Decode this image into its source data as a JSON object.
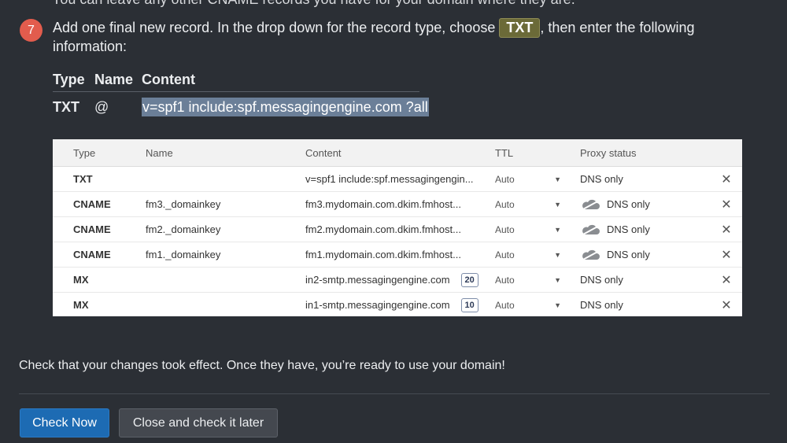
{
  "intro_cut_text": "You can leave any other CNAME records you have for your domain where they are.",
  "step": {
    "number": "7",
    "text_before": "Add one final new record. In the drop down for the record type, choose ",
    "tag": "TXT",
    "text_after": ", then enter the following information:"
  },
  "summary": {
    "headers": [
      "Type",
      "Name",
      "Content"
    ],
    "type": "TXT",
    "name": "@",
    "content": "v=spf1 include:spf.messagingengine.com ?all"
  },
  "dns_panel": {
    "headers": {
      "type": "Type",
      "name": "Name",
      "content": "Content",
      "ttl": "TTL",
      "proxy": "Proxy status"
    },
    "rows": [
      {
        "type": "TXT",
        "name": "",
        "content": "v=spf1 include:spf.messagingengin...",
        "priority": "",
        "ttl": "Auto",
        "proxy": "DNS only",
        "cloud": false
      },
      {
        "type": "CNAME",
        "name": "fm3._domainkey",
        "content": "fm3.mydomain.com.dkim.fmhost...",
        "priority": "",
        "ttl": "Auto",
        "proxy": "DNS only",
        "cloud": true
      },
      {
        "type": "CNAME",
        "name": "fm2._domainkey",
        "content": "fm2.mydomain.com.dkim.fmhost...",
        "priority": "",
        "ttl": "Auto",
        "proxy": "DNS only",
        "cloud": true
      },
      {
        "type": "CNAME",
        "name": "fm1._domainkey",
        "content": "fm1.mydomain.com.dkim.fmhost...",
        "priority": "",
        "ttl": "Auto",
        "proxy": "DNS only",
        "cloud": true
      },
      {
        "type": "MX",
        "name": "",
        "content": "in2-smtp.messagingengine.com",
        "priority": "20",
        "ttl": "Auto",
        "proxy": "DNS only",
        "cloud": false
      },
      {
        "type": "MX",
        "name": "",
        "content": "in1-smtp.messagingengine.com",
        "priority": "10",
        "ttl": "Auto",
        "proxy": "DNS only",
        "cloud": false
      }
    ],
    "delete_glyph": "✕",
    "caret_glyph": "▼"
  },
  "check_text": "Check that your changes took effect. Once they have, you’re ready to use your domain!",
  "buttons": {
    "check_now": "Check Now",
    "close_later": "Close and check it later"
  },
  "colors": {
    "background": "#2b2f35",
    "step_badge": "#e25c4d",
    "primary_button": "#1d6bb3",
    "tag_bg": "#6b6a38",
    "selection": "#6b7f98"
  }
}
